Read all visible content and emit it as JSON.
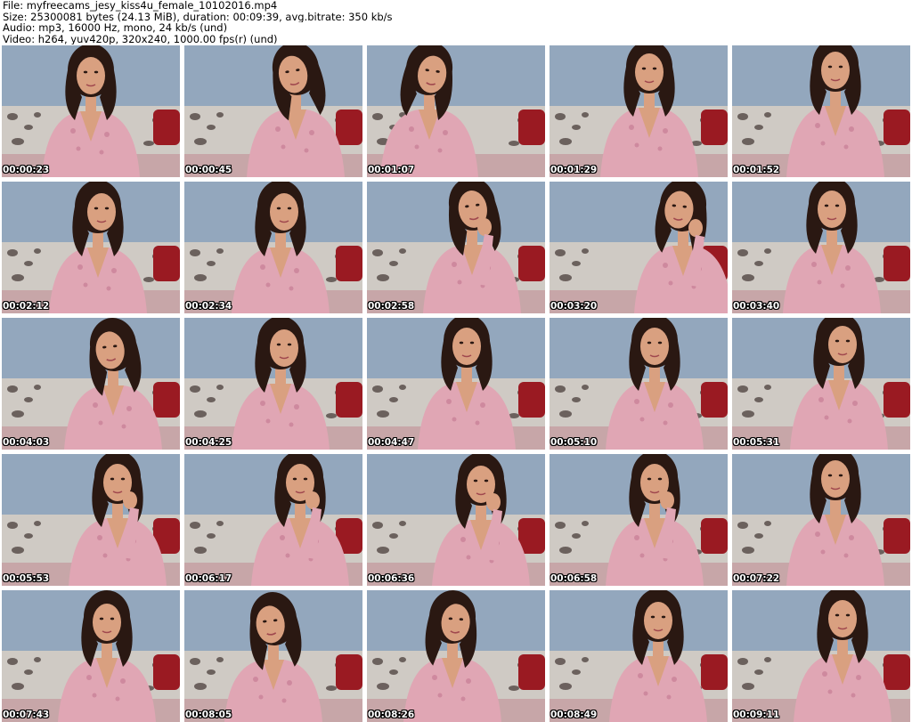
{
  "header": {
    "file_line": "File: myfreecams_jesy_kiss4u_female_10102016.mp4",
    "size_line": "Size: 25300081 bytes (24.13 MiB), duration: 00:09:39, avg.bitrate: 350 kb/s",
    "audio_line": "Audio: mp3, 16000 Hz, mono, 24 kb/s (und)",
    "video_line": "Video: h264, yuv420p, 320x240, 1000.00 fps(r) (und)"
  },
  "colors": {
    "wall": "#93a7bd",
    "sweater": "#e0a6b4",
    "skin": "#d9a080",
    "hair": "#2a1812",
    "sofa": "#cfcac4",
    "pillow_red": "#9a1a22"
  },
  "thumbnails": [
    {
      "timestamp": "00:00:23"
    },
    {
      "timestamp": "00:00:45"
    },
    {
      "timestamp": "00:01:07"
    },
    {
      "timestamp": "00:01:29"
    },
    {
      "timestamp": "00:01:52"
    },
    {
      "timestamp": "00:02:12"
    },
    {
      "timestamp": "00:02:34"
    },
    {
      "timestamp": "00:02:58"
    },
    {
      "timestamp": "00:03:20"
    },
    {
      "timestamp": "00:03:40"
    },
    {
      "timestamp": "00:04:03"
    },
    {
      "timestamp": "00:04:25"
    },
    {
      "timestamp": "00:04:47"
    },
    {
      "timestamp": "00:05:10"
    },
    {
      "timestamp": "00:05:31"
    },
    {
      "timestamp": "00:05:53"
    },
    {
      "timestamp": "00:06:17"
    },
    {
      "timestamp": "00:06:36"
    },
    {
      "timestamp": "00:06:58"
    },
    {
      "timestamp": "00:07:22"
    },
    {
      "timestamp": "00:07:43"
    },
    {
      "timestamp": "00:08:05"
    },
    {
      "timestamp": "00:08:26"
    },
    {
      "timestamp": "00:08:49"
    },
    {
      "timestamp": "00:09:11"
    }
  ]
}
